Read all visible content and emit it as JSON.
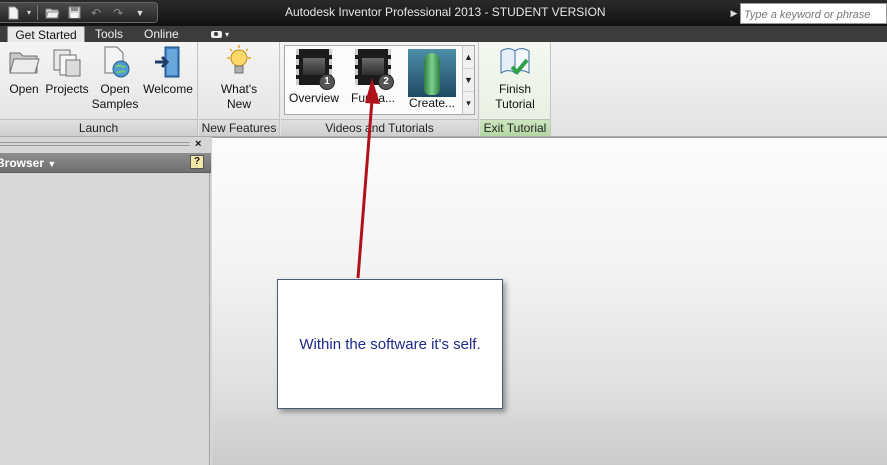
{
  "titlebar": {
    "title": "Autodesk Inventor Professional 2013 - STUDENT VERSION",
    "search_placeholder": "Type a keyword or phrase",
    "qat_icons": [
      "new-document-icon",
      "open-folder-icon",
      "save-icon",
      "undo-icon",
      "redo-icon",
      "customize-dropdown-icon"
    ]
  },
  "tabs": [
    {
      "label": "Get Started",
      "active": true
    },
    {
      "label": "Tools"
    },
    {
      "label": "Online"
    }
  ],
  "ribbon": {
    "launch": {
      "label": "Launch",
      "buttons": [
        {
          "line1": "Open",
          "line2": "",
          "icon": "open-folder-icon"
        },
        {
          "line1": "Projects",
          "line2": "",
          "icon": "projects-icon"
        },
        {
          "line1": "Open",
          "line2": "Samples",
          "icon": "open-samples-icon"
        },
        {
          "line1": "Welcome",
          "line2": "",
          "icon": "welcome-icon"
        }
      ]
    },
    "new_features": {
      "label": "New Features",
      "buttons": [
        {
          "line1": "What's",
          "line2": "New",
          "icon": "lightbulb-icon"
        }
      ]
    },
    "videos": {
      "label": "Videos and Tutorials",
      "items": [
        {
          "label": "Overview",
          "badge": "1",
          "icon": "video-film-icon"
        },
        {
          "label": "Funda...",
          "badge": "2",
          "icon": "video-film-icon"
        },
        {
          "label": "Create...",
          "icon": "vase-model-icon"
        }
      ]
    },
    "exit_tutorial": {
      "label": "Exit Tutorial",
      "buttons": [
        {
          "line1": "Finish",
          "line2": "Tutorial",
          "icon": "finish-tutorial-icon"
        }
      ]
    }
  },
  "browser": {
    "title": "Browser",
    "help": "?",
    "close": "×"
  },
  "callout": {
    "text": "Within the software it's self."
  },
  "colors": {
    "annotation_arrow": "#b0121b",
    "callout_text": "#1f2a8a",
    "titlebar": "#1a1a1a"
  }
}
